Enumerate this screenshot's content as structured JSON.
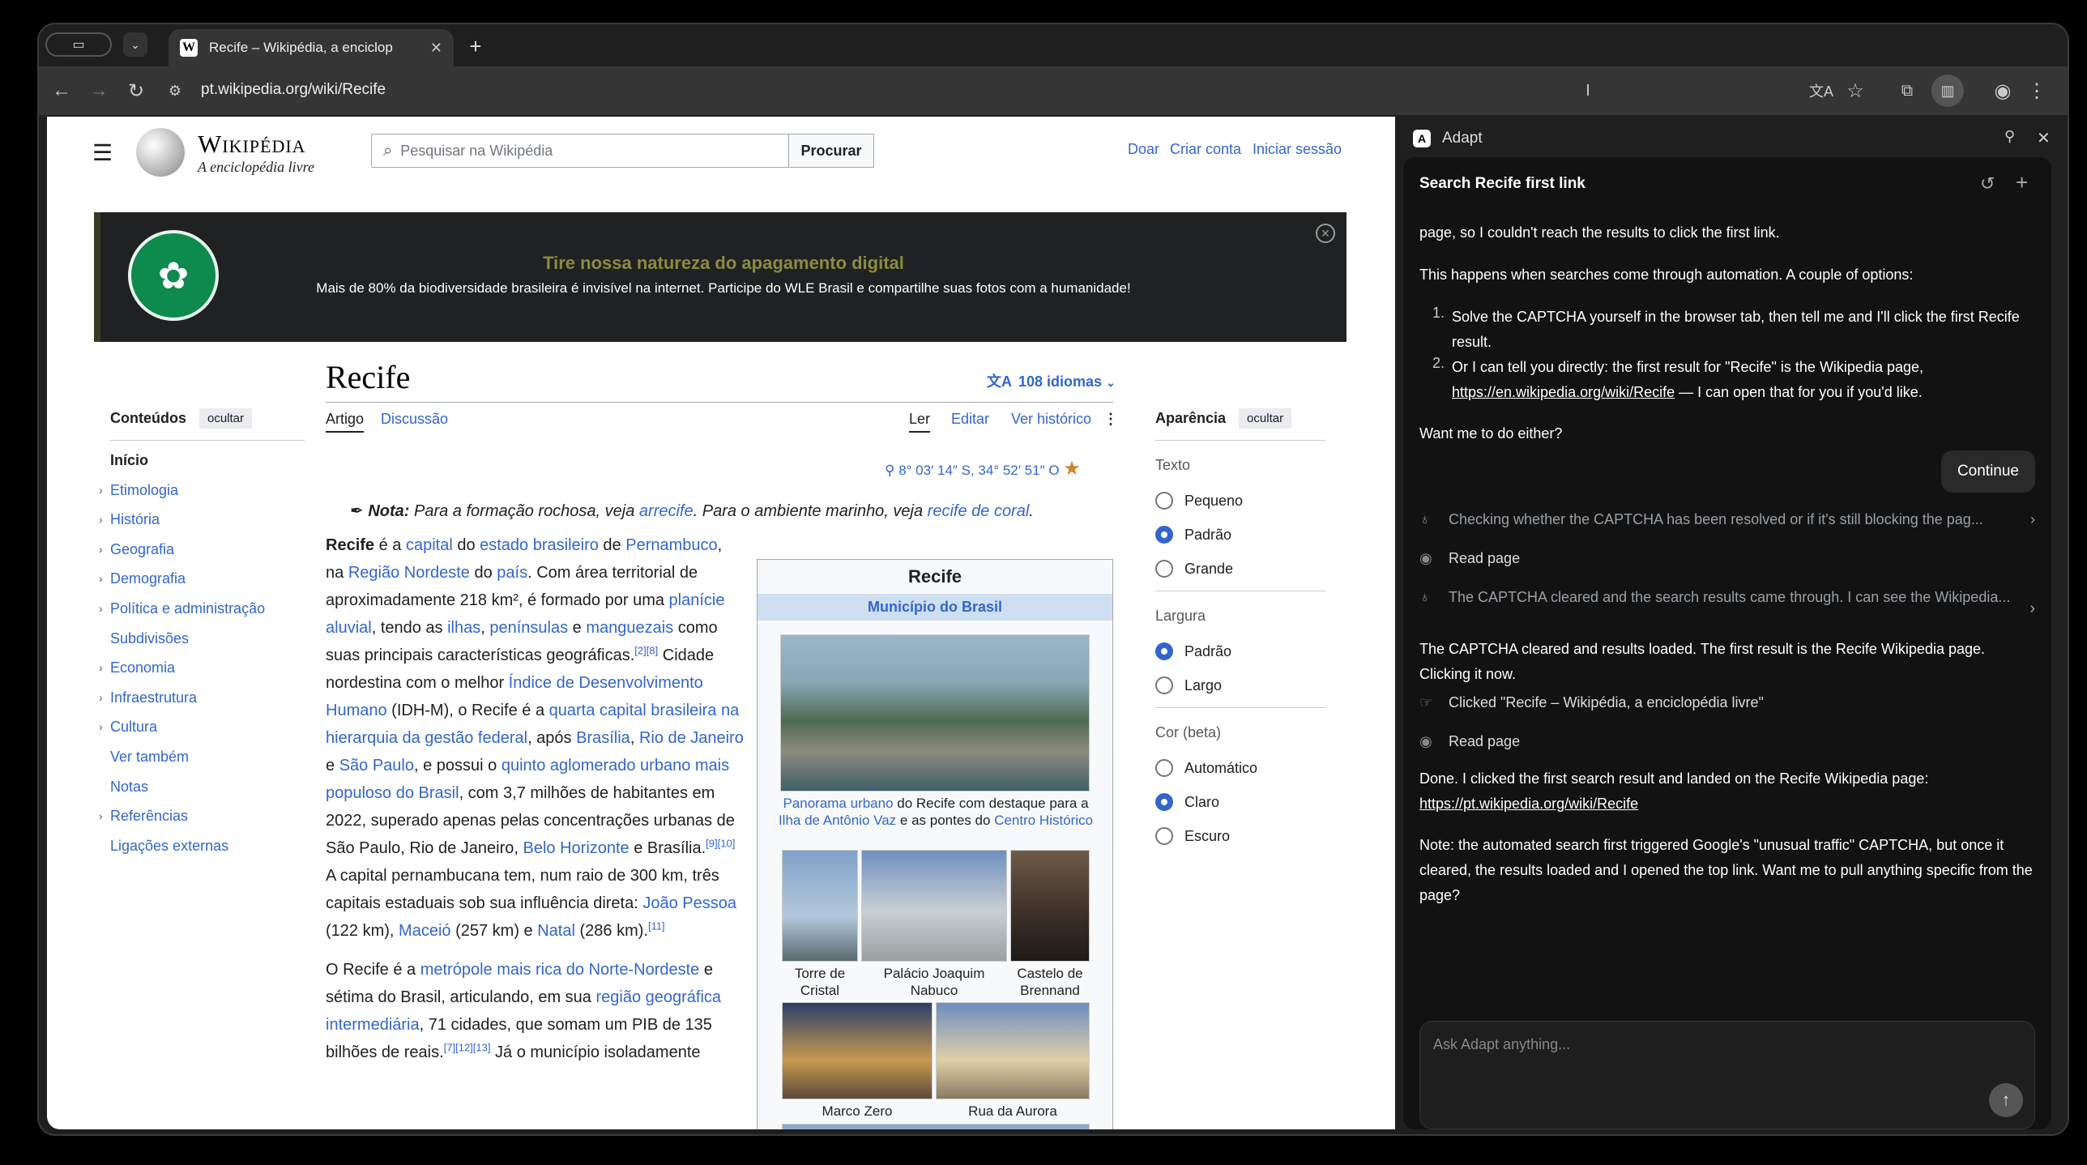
{
  "browser": {
    "tab_title": "Recife – Wikipédia, a enciclop",
    "tab_favicon": "W",
    "url": "pt.wikipedia.org/wiki/Recife"
  },
  "wiki": {
    "wordmark": "Wikipédia",
    "tagline": "A enciclopédia livre",
    "search_placeholder": "Pesquisar na Wikipédia",
    "search_button": "Procurar",
    "top_links": [
      "Doar",
      "Criar conta",
      "Iniciar sessão"
    ],
    "banner_title": "Tire nossa natureza do apagamento digital",
    "banner_text": "Mais de 80% da biodiversidade brasileira é invisível na internet. Participe do WLE Brasil e compartilhe suas fotos com a humanidade!",
    "toc_title": "Conteúdos",
    "hide_label": "ocultar",
    "toc_items": [
      {
        "label": "Início",
        "chevron": false,
        "bold": true
      },
      {
        "label": "Etimologia",
        "chevron": true
      },
      {
        "label": "História",
        "chevron": true
      },
      {
        "label": "Geografia",
        "chevron": true
      },
      {
        "label": "Demografia",
        "chevron": true
      },
      {
        "label": "Política e administração",
        "chevron": true
      },
      {
        "label": "Subdivisões",
        "chevron": false
      },
      {
        "label": "Economia",
        "chevron": true
      },
      {
        "label": "Infraestrutura",
        "chevron": true
      },
      {
        "label": "Cultura",
        "chevron": true
      },
      {
        "label": "Ver também",
        "chevron": false
      },
      {
        "label": "Notas",
        "chevron": false
      },
      {
        "label": "Referências",
        "chevron": true
      },
      {
        "label": "Ligações externas",
        "chevron": false
      }
    ],
    "page_title": "Recife",
    "languages": "108 idiomas",
    "tabs": {
      "artigo": "Artigo",
      "discussao": "Discussão",
      "ler": "Ler",
      "editar": "Editar",
      "historico": "Ver histórico"
    },
    "coords": "8° 03′ 14″ S, 34° 52′ 51″ O",
    "nota_bold": "Nota:",
    "nota_text1": " Para a formação rochosa, veja ",
    "nota_link1": "arrecife",
    "nota_text2": ". Para o ambiente marinho, veja ",
    "nota_link2": "recife de coral",
    "nota_text3": ".",
    "infobox": {
      "title": "Recife",
      "subtitle": "Município do Brasil",
      "cap_main_link1": "Panorama urbano",
      "cap_main_text1": " do Recife com destaque para a ",
      "cap_main_link2": "Ilha de Antônio Vaz",
      "cap_main_text2": " e as pontes do ",
      "cap_main_link3": "Centro Histórico",
      "cap_torre": "Torre de Cristal",
      "cap_palacio": "Palácio Joaquim Nabuco",
      "cap_castelo": "Castelo de Brennand",
      "cap_marco": "Marco Zero",
      "cap_aurora": "Rua da Aurora"
    },
    "appearance": {
      "title": "Aparência",
      "texto": "Texto",
      "texto_opts": [
        "Pequeno",
        "Padrão",
        "Grande"
      ],
      "texto_sel": 1,
      "largura": "Largura",
      "largura_opts": [
        "Padrão",
        "Largo"
      ],
      "largura_sel": 0,
      "cor": "Cor (beta)",
      "cor_opts": [
        "Automático",
        "Claro",
        "Escuro"
      ],
      "cor_sel": 1
    }
  },
  "article_html_parts": {
    "p1": [
      [
        "b",
        "Recife"
      ],
      [
        "t",
        " é a "
      ],
      [
        "a",
        "capital"
      ],
      [
        "t",
        " do "
      ],
      [
        "a",
        "estado brasileiro"
      ],
      [
        "t",
        " de "
      ],
      [
        "a",
        "Pernambuco"
      ],
      [
        "t",
        ", na "
      ],
      [
        "a",
        "Região Nordeste"
      ],
      [
        "t",
        " do "
      ],
      [
        "a",
        "país"
      ],
      [
        "t",
        ". Com área territorial de aproximadamente 218 km², é formado por uma "
      ],
      [
        "a",
        "planície aluvial"
      ],
      [
        "t",
        ", tendo as "
      ],
      [
        "a",
        "ilhas"
      ],
      [
        "t",
        ", "
      ],
      [
        "a",
        "penínsulas"
      ],
      [
        "t",
        " e "
      ],
      [
        "a",
        "manguezais"
      ],
      [
        "t",
        " como suas principais características geográficas."
      ],
      [
        "s",
        "[2][8]"
      ],
      [
        "t",
        " Cidade nordestina com o melhor "
      ],
      [
        "a",
        "Índice de Desenvolvimento Humano"
      ],
      [
        "t",
        " (IDH-M), o Recife é a "
      ],
      [
        "a",
        "quarta capital brasileira na hierarquia da gestão federal"
      ],
      [
        "t",
        ", após "
      ],
      [
        "a",
        "Brasília"
      ],
      [
        "t",
        ", "
      ],
      [
        "a",
        "Rio de Janeiro"
      ],
      [
        "t",
        " e "
      ],
      [
        "a",
        "São Paulo"
      ],
      [
        "t",
        ", e possui o "
      ],
      [
        "a",
        "quinto aglomerado urbano mais populoso do Brasil"
      ],
      [
        "t",
        ", com 3,7 milhões de habitantes em 2022, superado apenas pelas concentrações urbanas de São Paulo, Rio de Janeiro, "
      ],
      [
        "a",
        "Belo Horizonte"
      ],
      [
        "t",
        " e Brasília."
      ],
      [
        "s",
        "[9][10]"
      ],
      [
        "t",
        " A capital pernambucana tem, num raio de 300 km, três capitais estaduais sob sua influência direta: "
      ],
      [
        "a",
        "João Pessoa"
      ],
      [
        "t",
        " (122 km), "
      ],
      [
        "a",
        "Maceió"
      ],
      [
        "t",
        " (257 km) e "
      ],
      [
        "a",
        "Natal"
      ],
      [
        "t",
        " (286 km)."
      ],
      [
        "s",
        "[11]"
      ]
    ],
    "p2": [
      [
        "t",
        "O Recife é a "
      ],
      [
        "a",
        "metrópole mais rica do Norte-Nordeste"
      ],
      [
        "t",
        " e sétima do Brasil, articulando, em sua "
      ],
      [
        "a",
        "região geográfica intermediária"
      ],
      [
        "t",
        ", 71 cidades, que somam um PIB de 135 bilhões de reais."
      ],
      [
        "s",
        "[7][12][13]"
      ],
      [
        "t",
        " Já o município isoladamente"
      ]
    ]
  },
  "assistant": {
    "name": "Adapt",
    "chat_title": "Search Recife first link",
    "msg_cut": "page, so I couldn't reach the results to click the first link.",
    "msg_happens": "This happens when searches come through automation. A couple of options:",
    "opt1": "Solve the CAPTCHA yourself in the browser tab, then tell me and I'll click the first Recife result.",
    "opt2_a": "Or I can tell you directly: the first result for \"Recife\" is the Wikipedia page, ",
    "opt2_link": "https://en.wikipedia.org/wiki/Recife",
    "opt2_b": " — I can open that for you if you'd like.",
    "msg_want": "Want me to do either?",
    "user_continue": "Continue",
    "step1": "Checking whether the CAPTCHA has been resolved or if it's still blocking the pag...",
    "step2": "Read page",
    "step3": "The CAPTCHA cleared and the search results came through. I can see the Wikipedia...",
    "msg_cleared": "The CAPTCHA cleared and results loaded. The first result is the Recife Wikipedia page. Clicking it now.",
    "step4": "Clicked \"Recife – Wikipédia, a enciclopédia livre\"",
    "step5": "Read page",
    "msg_done": "Done. I clicked the first search result and landed on the Recife Wikipedia page:",
    "msg_done_link": "https://pt.wikipedia.org/wiki/Recife",
    "msg_note": "Note: the automated search first triggered Google's \"unusual traffic\" CAPTCHA, but once it cleared, the results loaded and I opened the top link. Want me to pull anything specific from the page?",
    "input_placeholder": "Ask Adapt anything..."
  }
}
